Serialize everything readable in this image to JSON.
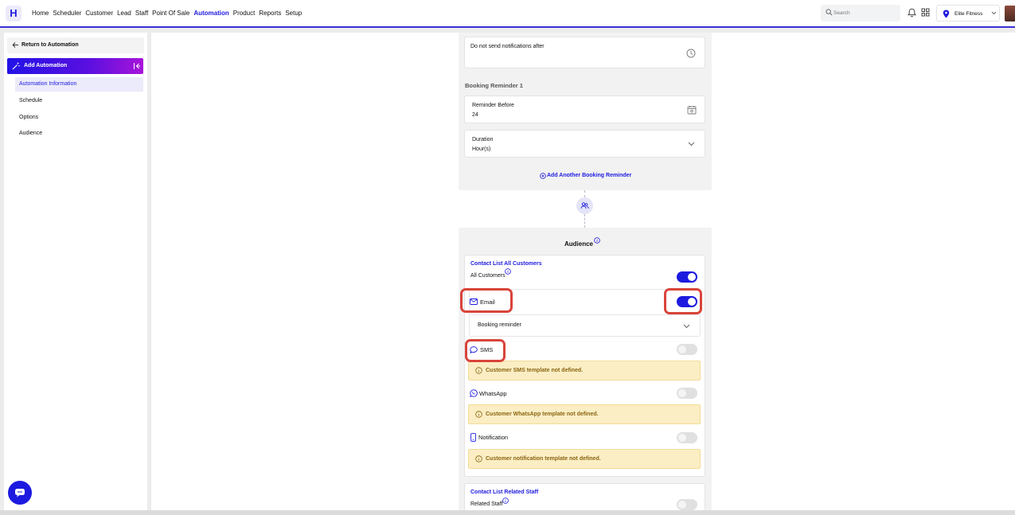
{
  "brand": {
    "logo_letter": "H",
    "accent": "#1d1ae0"
  },
  "nav": {
    "items": [
      "Home",
      "Scheduler",
      "Customer",
      "Lead",
      "Staff",
      "Point Of Sale",
      "Automation",
      "Product",
      "Reports",
      "Setup"
    ],
    "active": "Automation"
  },
  "header": {
    "search_placeholder": "Search",
    "location": "Elite Fitness"
  },
  "sidebar": {
    "return_label": "Return to Automation",
    "add_label": "Add Automation",
    "items": [
      "Automation Information",
      "Schedule",
      "Options",
      "Audience"
    ],
    "active_item": "Automation Information"
  },
  "options_panel": {
    "quiet_label": "Do not send notifications after",
    "reminder_title": "Booking Reminder 1",
    "reminder_before_label": "Reminder Before",
    "reminder_before_value": "24",
    "duration_label": "Duration",
    "duration_value": "Hour(s)",
    "add_reminder": "Add Another Booking Reminder"
  },
  "audience": {
    "title": "Audience",
    "customers": {
      "heading": "Contact List All Customers",
      "all_label": "All Customers",
      "all_on": true,
      "email_label": "Email",
      "email_on": true,
      "email_template": "Booking reminder",
      "sms_label": "SMS",
      "sms_on": false,
      "sms_warning": "Customer SMS template not defined.",
      "whatsapp_label": "WhatsApp",
      "whatsapp_on": false,
      "whatsapp_warning": "Customer WhatsApp template not defined.",
      "notification_label": "Notification",
      "notification_on": false,
      "notification_warning": "Customer notification template not defined."
    },
    "staff": {
      "heading": "Contact List Related Staff",
      "related_label": "Related Staff",
      "related_on": false
    }
  },
  "annotations": {
    "highlight_color": "#d9443a"
  }
}
